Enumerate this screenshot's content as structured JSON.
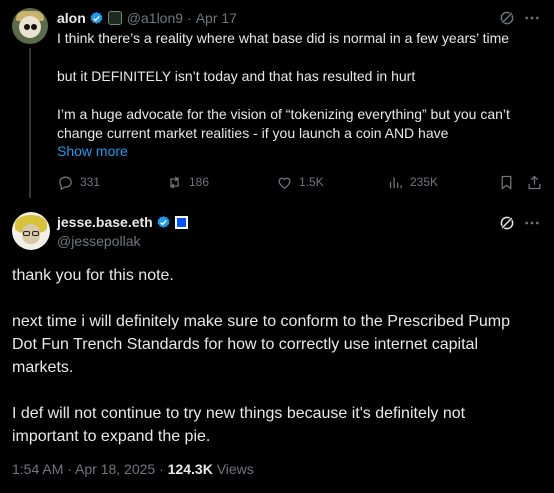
{
  "parent": {
    "name": "alon",
    "handle": "@a1lon9",
    "separator": "·",
    "date": "Apr 17",
    "lines": [
      "I think there’s a reality where what base did is normal in a few years’ time",
      "",
      "but it DEFINITELY isn’t today and that has resulted in hurt",
      "",
      "I’m a huge advocate for the vision of “tokenizing everything” but you can’t",
      "change current market realities - if you launch a coin AND have"
    ],
    "show_more": "Show more",
    "actions": {
      "replies": "331",
      "reposts": "186",
      "likes": "1.5K",
      "views": "235K"
    }
  },
  "main": {
    "name": "jesse.base.eth",
    "handle": "@jessepollak",
    "lines": [
      "thank you for this note.",
      "",
      "next time i will definitely make sure to conform to the Prescribed Pump",
      "Dot Fun Trench Standards for how to correctly use internet capital",
      "markets.",
      "",
      "I def will not continue to try new things because it's definitely not",
      "important to expand the pie."
    ],
    "timestamp": "1:54 AM · Apr 18, 2025 · ",
    "views_count": "124.3K",
    "views_label": " Views"
  },
  "colors": {
    "background": "#000000",
    "text": "#e7e9ea",
    "muted": "#71767b",
    "accent": "#1d9bf0",
    "base_blue": "#0052ff"
  },
  "icons": [
    "verified-icon",
    "grok-icon",
    "more-icon",
    "reply-icon",
    "repost-icon",
    "like-icon",
    "views-icon",
    "bookmark-icon",
    "share-icon"
  ]
}
